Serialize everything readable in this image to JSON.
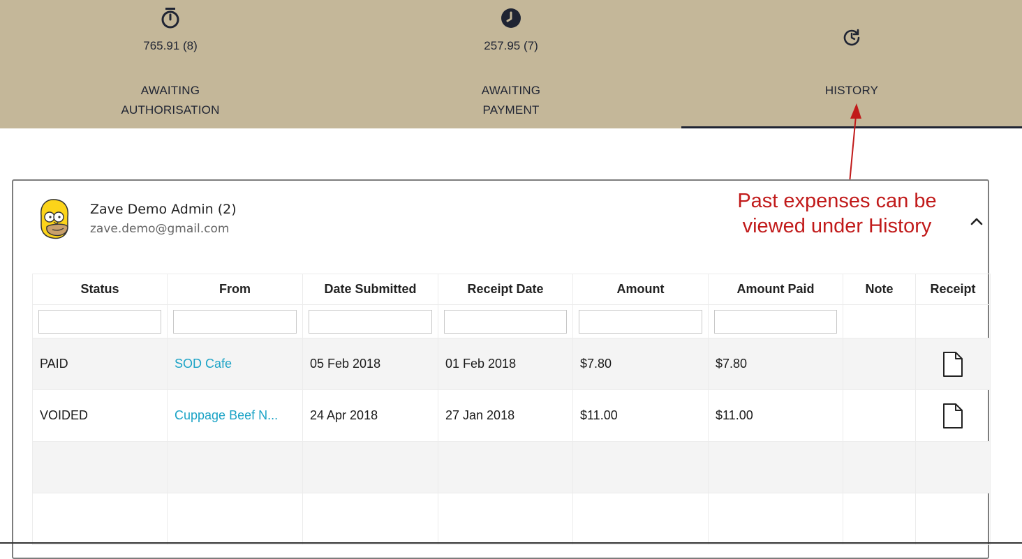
{
  "tabs": [
    {
      "icon": "stopwatch-icon",
      "value": "765.91 (8)",
      "label_line1": "AWAITING",
      "label_line2": "AUTHORISATION",
      "active": false
    },
    {
      "icon": "clock-icon",
      "value": "257.95 (7)",
      "label_line1": "AWAITING",
      "label_line2": "PAYMENT",
      "active": false
    },
    {
      "icon": "history-icon",
      "value": "",
      "label_line1": "HISTORY",
      "label_line2": "",
      "active": true
    }
  ],
  "annotation": {
    "line1": "Past expenses can be",
    "line2": "viewed under History",
    "color": "#c11a1a"
  },
  "user": {
    "avatar_icon": "homer-avatar",
    "name": "Zave Demo Admin (2)",
    "email": "zave.demo@gmail.com",
    "collapse_icon": "chevron-up-icon"
  },
  "table": {
    "columns": [
      "Status",
      "From",
      "Date Submitted",
      "Receipt Date",
      "Amount",
      "Amount Paid",
      "Note",
      "Receipt"
    ],
    "rows": [
      {
        "status": "PAID",
        "from": "SOD Cafe",
        "date_submitted": "05 Feb 2018",
        "receipt_date": "01 Feb 2018",
        "amount": "$7.80",
        "amount_paid": "$7.80",
        "note": "",
        "receipt_icon": "document-icon"
      },
      {
        "status": "VOIDED",
        "from": "Cuppage Beef N...",
        "date_submitted": "24 Apr 2018",
        "receipt_date": "27 Jan 2018",
        "amount": "$11.00",
        "amount_paid": "$11.00",
        "note": "",
        "receipt_icon": "document-icon"
      }
    ]
  },
  "colors": {
    "tab_bar": "#c4b799",
    "tab_text": "#1f2433",
    "link": "#1ba3c6",
    "row_shade": "#f4f4f4"
  }
}
